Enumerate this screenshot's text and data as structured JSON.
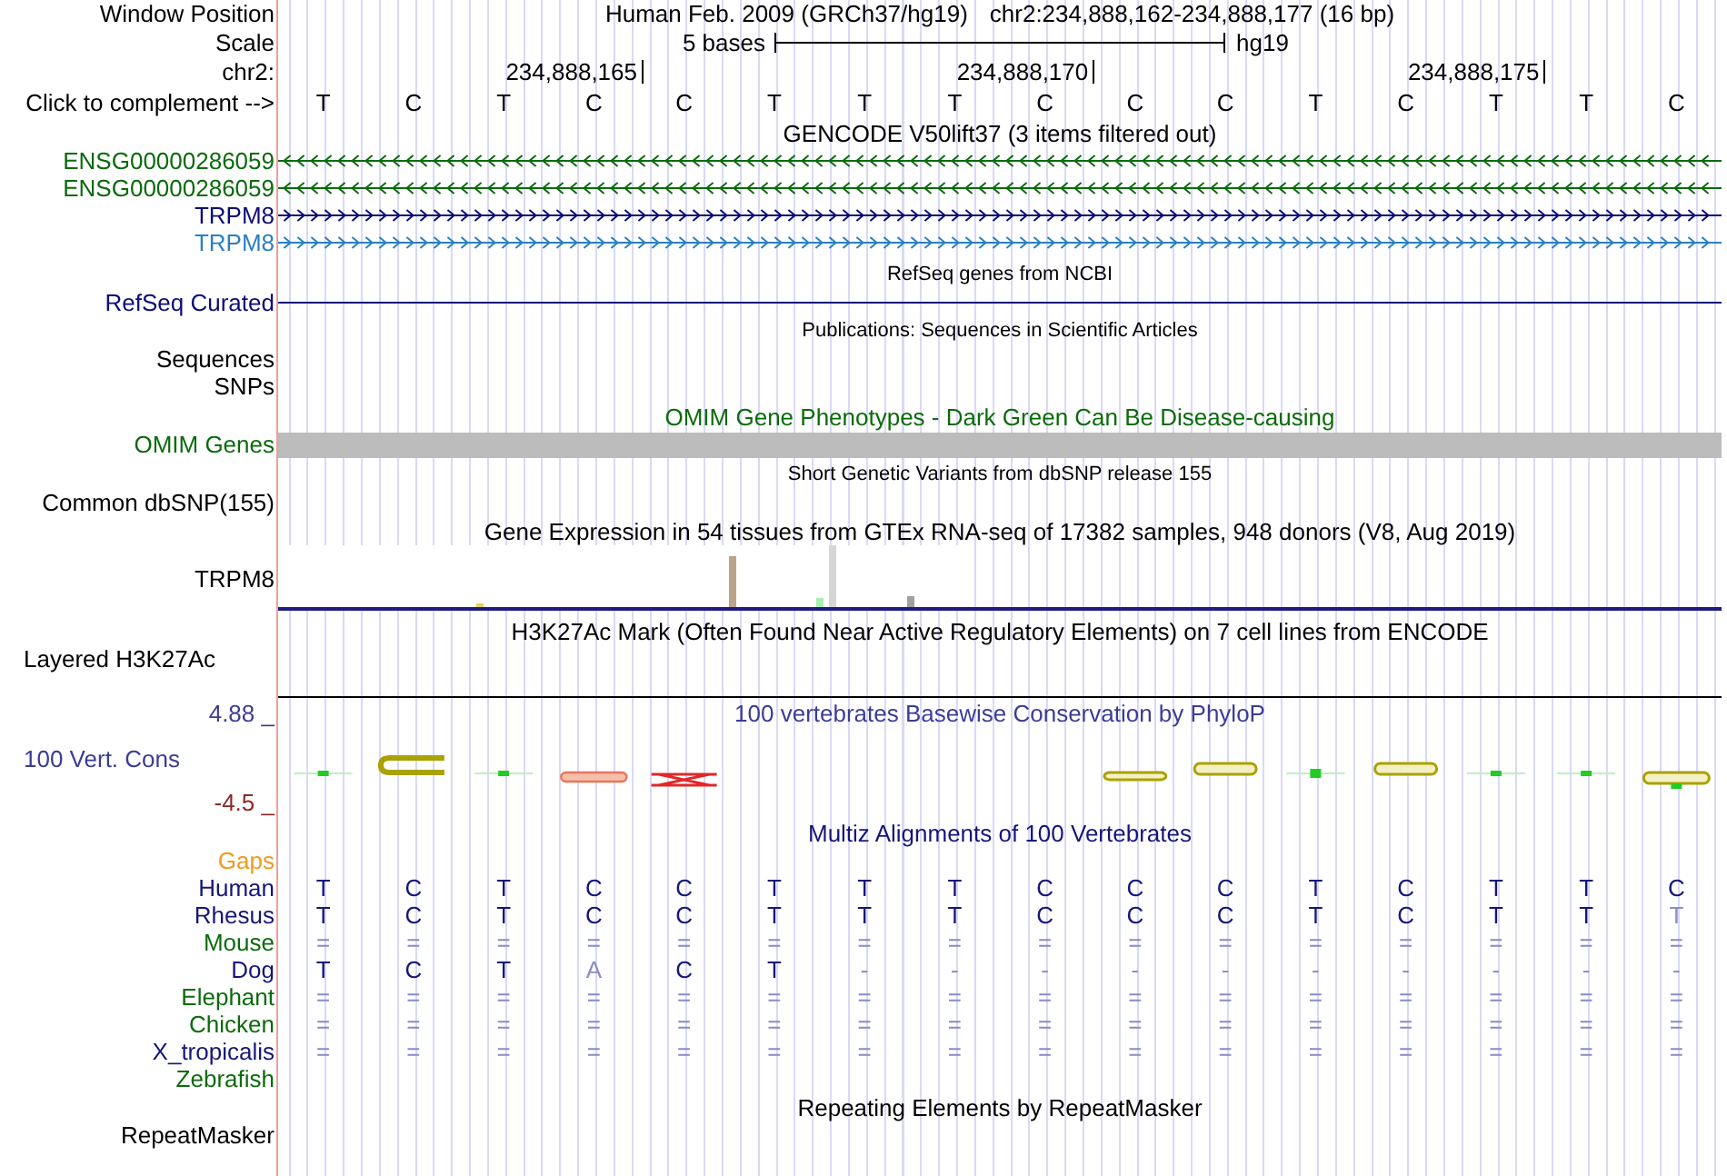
{
  "window_position": {
    "label": "Window Position",
    "assembly": "Human Feb. 2009 (GRCh37/hg19)",
    "range": "chr2:234,888,162-234,888,177 (16 bp)"
  },
  "scale": {
    "label": "Scale",
    "length": "5 bases",
    "assembly": "hg19"
  },
  "ruler": {
    "label": "chr2:"
  },
  "sequence": {
    "label": "Click to complement -->",
    "bases": [
      {
        "text": "T"
      },
      {
        "text": "C"
      },
      {
        "text": "T"
      },
      {
        "text": "C",
        "tick": "234,888,165"
      },
      {
        "text": "C"
      },
      {
        "text": "T"
      },
      {
        "text": "T"
      },
      {
        "text": "T"
      },
      {
        "text": "C",
        "tick": "234,888,170"
      },
      {
        "text": "C"
      },
      {
        "text": "C"
      },
      {
        "text": "T"
      },
      {
        "text": "C"
      },
      {
        "text": "T",
        "tick": "234,888,175"
      },
      {
        "text": "T"
      },
      {
        "text": "C"
      }
    ]
  },
  "tracks": [
    {
      "kind": "gene",
      "title": "GENCODE V50lift37 (3 items filtered out)",
      "color": "#000000",
      "items": [
        {
          "name": "ENSG00000286059",
          "reverse_strand": true,
          "color": "#0b6b0b"
        },
        {
          "name": "ENSG00000286059",
          "reverse_strand": true,
          "color": "#0b6b0b"
        },
        {
          "name": "TRPM8",
          "reverse_strand": false,
          "color": "#0c0c78"
        },
        {
          "name": "TRPM8",
          "reverse_strand": false,
          "color": "#2a80c0"
        }
      ]
    },
    {
      "kind": "refseq",
      "title": "RefSeq genes from NCBI",
      "color": "#000000",
      "items": [
        {
          "name": "RefSeq Curated",
          "color": "#0c0c78"
        }
      ]
    },
    {
      "kind": "publications",
      "title": "Publications: Sequences in Scientific Articles",
      "color": "#000000",
      "items": [
        {
          "name": "Sequences",
          "color": "#000000"
        },
        {
          "name": "SNPs",
          "color": "#000000"
        }
      ]
    },
    {
      "kind": "omim",
      "title": "OMIM Gene Phenotypes - Dark Green Can Be Disease-causing",
      "color": "#0b6b0b",
      "items": [
        {
          "name": "OMIM Genes",
          "color": "#0b6b0b"
        }
      ]
    },
    {
      "kind": "variants",
      "title": "Short Genetic Variants from dbSNP release 155",
      "color": "#000000",
      "items": [
        {
          "name": "Common dbSNP(155)",
          "color": "#000000"
        }
      ]
    },
    {
      "kind": "expression",
      "title": "Gene Expression in 54 tissues from GTEx RNA-seq of 17382 samples, 948 donors (V8, Aug 2019)",
      "color": "#000000",
      "items": [
        {
          "name": "TRPM8",
          "color": "#000000"
        }
      ]
    },
    {
      "kind": "multiwig",
      "title": "H3K27Ac Mark (Often Found Near Active Regulatory Elements) on 7 cell lines from ENCODE",
      "color": "#000000",
      "items": [
        {
          "name": "Layered H3K27Ac",
          "color": "#000000"
        }
      ]
    },
    {
      "kind": "conservation",
      "title": "100 vertebrates Basewise Conservation by PhyloP",
      "color": "#3c3c96",
      "items": [
        {
          "name": "100 Vert. Cons",
          "color": "#3c3c96"
        }
      ],
      "axis": [
        {
          "text": "4.88 _",
          "color": "#3c3c96"
        },
        {
          "text": "-4.5 _",
          "color": "#8c2828"
        }
      ]
    },
    {
      "kind": "alignment",
      "title": "Multiz Alignments of 100 Vertebrates",
      "color": "#16167a",
      "items": [
        {
          "name": "Gaps",
          "color": "#ef9a1f"
        },
        {
          "name": "Human",
          "color": "#16167a",
          "bases": [
            {
              "text": "T",
              "faded": false
            },
            {
              "text": "C",
              "faded": false
            },
            {
              "text": "T",
              "faded": false
            },
            {
              "text": "C",
              "faded": false
            },
            {
              "text": "C",
              "faded": false
            },
            {
              "text": "T",
              "faded": false
            },
            {
              "text": "T",
              "faded": false
            },
            {
              "text": "T",
              "faded": false
            },
            {
              "text": "C",
              "faded": false
            },
            {
              "text": "C",
              "faded": false
            },
            {
              "text": "C",
              "faded": false
            },
            {
              "text": "T",
              "faded": false
            },
            {
              "text": "C",
              "faded": false
            },
            {
              "text": "T",
              "faded": false
            },
            {
              "text": "T",
              "faded": false
            },
            {
              "text": "C",
              "faded": false
            }
          ]
        },
        {
          "name": "Rhesus",
          "color": "#16167a",
          "bases": [
            {
              "text": "T",
              "faded": false
            },
            {
              "text": "C",
              "faded": false
            },
            {
              "text": "T",
              "faded": false
            },
            {
              "text": "C",
              "faded": false
            },
            {
              "text": "C",
              "faded": false
            },
            {
              "text": "T",
              "faded": false
            },
            {
              "text": "T",
              "faded": false
            },
            {
              "text": "T",
              "faded": false
            },
            {
              "text": "C",
              "faded": false
            },
            {
              "text": "C",
              "faded": false
            },
            {
              "text": "C",
              "faded": false
            },
            {
              "text": "T",
              "faded": false
            },
            {
              "text": "C",
              "faded": false
            },
            {
              "text": "T",
              "faded": false
            },
            {
              "text": "T",
              "faded": false
            },
            {
              "text": "T",
              "faded": true
            }
          ]
        },
        {
          "name": "Mouse",
          "color": "#0b6b0b",
          "bases": [
            {
              "text": "=",
              "faded": true
            },
            {
              "text": "=",
              "faded": true
            },
            {
              "text": "=",
              "faded": true
            },
            {
              "text": "=",
              "faded": true
            },
            {
              "text": "=",
              "faded": true
            },
            {
              "text": "=",
              "faded": true
            },
            {
              "text": "=",
              "faded": true
            },
            {
              "text": "=",
              "faded": true
            },
            {
              "text": "=",
              "faded": true
            },
            {
              "text": "=",
              "faded": true
            },
            {
              "text": "=",
              "faded": true
            },
            {
              "text": "=",
              "faded": true
            },
            {
              "text": "=",
              "faded": true
            },
            {
              "text": "=",
              "faded": true
            },
            {
              "text": "=",
              "faded": true
            },
            {
              "text": "=",
              "faded": true
            }
          ]
        },
        {
          "name": "Dog",
          "color": "#16167a",
          "bases": [
            {
              "text": "T",
              "faded": false
            },
            {
              "text": "C",
              "faded": false
            },
            {
              "text": "T",
              "faded": false
            },
            {
              "text": "A",
              "faded": true
            },
            {
              "text": "C",
              "faded": false
            },
            {
              "text": "T",
              "faded": false
            },
            {
              "text": "-",
              "faded": true
            },
            {
              "text": "-",
              "faded": true
            },
            {
              "text": "-",
              "faded": true
            },
            {
              "text": "-",
              "faded": true
            },
            {
              "text": "-",
              "faded": true
            },
            {
              "text": "-",
              "faded": true
            },
            {
              "text": "-",
              "faded": true
            },
            {
              "text": "-",
              "faded": true
            },
            {
              "text": "-",
              "faded": true
            },
            {
              "text": "-",
              "faded": true
            }
          ]
        },
        {
          "name": "Elephant",
          "color": "#0b6b0b",
          "bases": [
            {
              "text": "=",
              "faded": true
            },
            {
              "text": "=",
              "faded": true
            },
            {
              "text": "=",
              "faded": true
            },
            {
              "text": "=",
              "faded": true
            },
            {
              "text": "=",
              "faded": true
            },
            {
              "text": "=",
              "faded": true
            },
            {
              "text": "=",
              "faded": true
            },
            {
              "text": "=",
              "faded": true
            },
            {
              "text": "=",
              "faded": true
            },
            {
              "text": "=",
              "faded": true
            },
            {
              "text": "=",
              "faded": true
            },
            {
              "text": "=",
              "faded": true
            },
            {
              "text": "=",
              "faded": true
            },
            {
              "text": "=",
              "faded": true
            },
            {
              "text": "=",
              "faded": true
            },
            {
              "text": "=",
              "faded": true
            }
          ]
        },
        {
          "name": "Chicken",
          "color": "#0b6b0b",
          "bases": [
            {
              "text": "=",
              "faded": true
            },
            {
              "text": "=",
              "faded": true
            },
            {
              "text": "=",
              "faded": true
            },
            {
              "text": "=",
              "faded": true
            },
            {
              "text": "=",
              "faded": true
            },
            {
              "text": "=",
              "faded": true
            },
            {
              "text": "=",
              "faded": true
            },
            {
              "text": "=",
              "faded": true
            },
            {
              "text": "=",
              "faded": true
            },
            {
              "text": "=",
              "faded": true
            },
            {
              "text": "=",
              "faded": true
            },
            {
              "text": "=",
              "faded": true
            },
            {
              "text": "=",
              "faded": true
            },
            {
              "text": "=",
              "faded": true
            },
            {
              "text": "=",
              "faded": true
            },
            {
              "text": "=",
              "faded": true
            }
          ]
        },
        {
          "name": "X_tropicalis",
          "color": "#16167a",
          "bases": [
            {
              "text": "=",
              "faded": true
            },
            {
              "text": "=",
              "faded": true
            },
            {
              "text": "=",
              "faded": true
            },
            {
              "text": "=",
              "faded": true
            },
            {
              "text": "=",
              "faded": true
            },
            {
              "text": "=",
              "faded": true
            },
            {
              "text": "=",
              "faded": true
            },
            {
              "text": "=",
              "faded": true
            },
            {
              "text": "=",
              "faded": true
            },
            {
              "text": "=",
              "faded": true
            },
            {
              "text": "=",
              "faded": true
            },
            {
              "text": "=",
              "faded": true
            },
            {
              "text": "=",
              "faded": true
            },
            {
              "text": "=",
              "faded": true
            },
            {
              "text": "=",
              "faded": true
            },
            {
              "text": "=",
              "faded": true
            }
          ]
        },
        {
          "name": "Zebrafish",
          "color": "#0b6b0b"
        }
      ]
    },
    {
      "kind": "repeats",
      "title": "Repeating Elements by RepeatMasker",
      "color": "#000000",
      "items": [
        {
          "name": "RepeatMasker",
          "color": "#000000"
        }
      ]
    }
  ]
}
